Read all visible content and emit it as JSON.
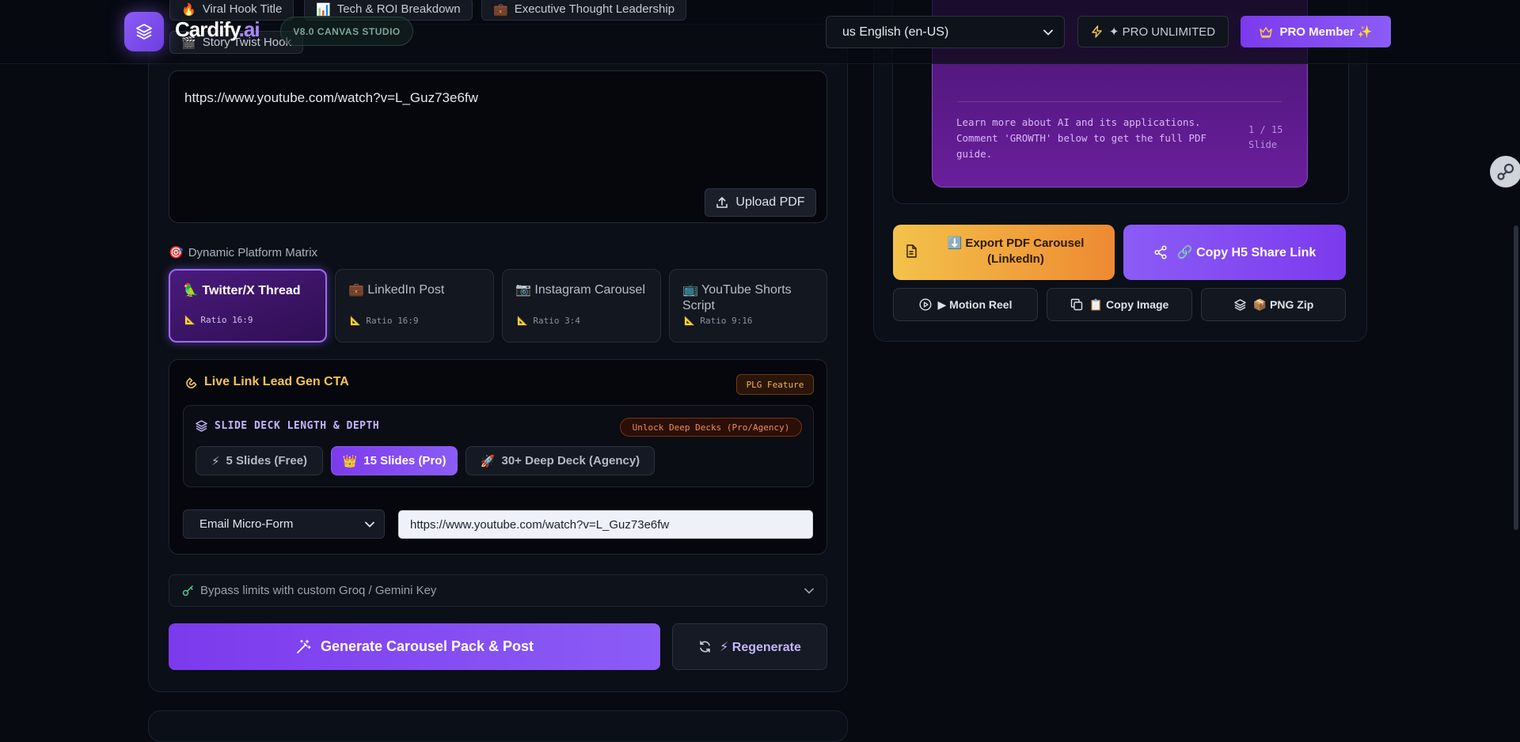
{
  "header": {
    "brand_name": "Cardify",
    "brand_suffix": ".ai",
    "version": "V8.0 CANVAS STUDIO",
    "language": "us English (en-US)",
    "pro_unlimited": "✦ PRO UNLIMITED",
    "pro_member": "PRO Member ✨"
  },
  "templates": [
    {
      "icon": "🔥",
      "label": "Viral Hook Title"
    },
    {
      "icon": "📊",
      "label": "Tech & ROI Breakdown"
    },
    {
      "icon": "💼",
      "label": "Executive Thought Leadership"
    },
    {
      "icon": "🎬",
      "label": "Story Twist Hook"
    }
  ],
  "source": {
    "url": "https://www.youtube.com/watch?v=L_Guz73e6fw",
    "upload_label": "Upload PDF"
  },
  "platforms": {
    "section_label": "Dynamic Platform Matrix",
    "section_icon": "🎯",
    "items": [
      {
        "icon": "🦜",
        "name": "Twitter/X Thread",
        "ratio": "Ratio 16:9",
        "active": true
      },
      {
        "icon": "💼",
        "name": "LinkedIn Post",
        "ratio": "Ratio 16:9",
        "active": false
      },
      {
        "icon": "📷",
        "name": "Instagram Carousel",
        "ratio": "Ratio 3:4",
        "active": false
      },
      {
        "icon": "📺",
        "name": "YouTube Shorts Script",
        "ratio": "Ratio 9:16",
        "active": false
      }
    ]
  },
  "cta": {
    "title": "Live Link Lead Gen CTA",
    "badge": "PLG Feature",
    "deck_title": "SLIDE DECK LENGTH & DEPTH",
    "deck_unlock": "Unlock Deep Decks (Pro/Agency)",
    "deck_options": [
      {
        "icon": "⚡",
        "label": "5 Slides (Free)",
        "active": false
      },
      {
        "icon": "👑",
        "label": "15 Slides (Pro)",
        "active": true
      },
      {
        "icon": "🚀",
        "label": "30+ Deep Deck (Agency)",
        "active": false
      }
    ],
    "form_type": "Email Micro-Form",
    "link_value": "https://www.youtube.com/watch?v=L_Guz73e6fw"
  },
  "bypass_label": "Bypass limits with custom Groq / Gemini Key",
  "actions": {
    "generate": "Generate Carousel Pack & Post",
    "regenerate": "⚡ Regenerate"
  },
  "preview": {
    "slide_text": "Learn more about AI and its applications. Comment 'GROWTH' below to get the full PDF guide.",
    "page": "1 / 15",
    "page_unit": "Slide"
  },
  "export": {
    "pdf_line1": "⬇️ Export PDF Carousel",
    "pdf_line2": "(LinkedIn)",
    "share": "🔗 Copy H5 Share Link",
    "motion": "▶ Motion Reel",
    "copy_image": "📋 Copy Image",
    "png_zip": "📦 PNG Zip"
  },
  "colors": {
    "accent": "#8b5cf6",
    "cta_gold": "#f5c453",
    "export_gradient": [
      "#f3c24a",
      "#ee8a32"
    ]
  }
}
